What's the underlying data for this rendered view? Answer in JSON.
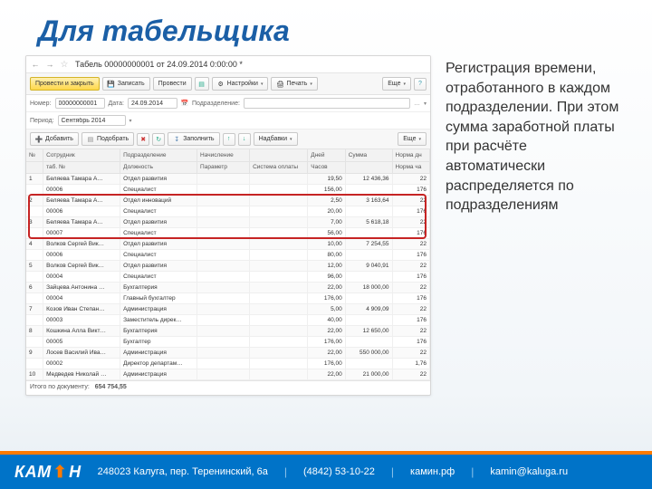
{
  "title": "Для табельщика",
  "side_text": "Регистрация времени, отработанного в каждом подразделении. При этом сумма заработной платы при расчёте автоматически распределяется по подразделениям",
  "app": {
    "doc_title": "Табель 00000000001 от 24.09.2014 0:00:00 *",
    "toolbar": {
      "post_close": "Провести и закрыть",
      "save": "Записать",
      "post": "Провести",
      "settings": "Настройки",
      "print": "Печать",
      "more": "Еще"
    },
    "form": {
      "number_lbl": "Номер:",
      "number": "00000000001",
      "date_lbl": "Дата:",
      "date": "24.09.2014",
      "sub_lbl": "Подразделение:",
      "sub": "",
      "period_lbl": "Период:",
      "period": "Сентябрь 2014"
    },
    "toolbar2": {
      "add": "Добавить",
      "pick": "Подобрать",
      "fill": "Заполнить",
      "bonus": "Надбавки",
      "more": "Еще"
    },
    "headers": {
      "r1": [
        "№",
        "Сотрудник",
        "Подразделение",
        "Начисление",
        "",
        "Дней",
        "Сумма",
        "Норма дн"
      ],
      "r2": [
        "",
        "таб. №",
        "Должность",
        "Параметр",
        "Система оплаты",
        "Часов",
        "",
        "Норма ча"
      ]
    },
    "rows": [
      {
        "n": "1",
        "emp": "Беляева Тамара А…",
        "dep": "Отдел развития",
        "calc": "",
        "sys": "",
        "days": "19,50",
        "sum": "12 436,36",
        "norm": "22"
      },
      {
        "n": "",
        "emp": "00006",
        "dep": "Специалист",
        "calc": "",
        "sys": "",
        "days": "156,00",
        "sum": "",
        "norm": "176"
      },
      {
        "n": "2",
        "emp": "Беляева Тамара А…",
        "dep": "Отдел инноваций",
        "calc": "",
        "sys": "",
        "days": "2,50",
        "sum": "3 163,64",
        "norm": "22"
      },
      {
        "n": "",
        "emp": "00006",
        "dep": "Специалист",
        "calc": "",
        "sys": "",
        "days": "20,00",
        "sum": "",
        "norm": "176"
      },
      {
        "n": "3",
        "emp": "Беляева Тамара А…",
        "dep": "Отдел развития",
        "calc": "",
        "sys": "",
        "days": "7,00",
        "sum": "5 618,18",
        "norm": "22"
      },
      {
        "n": "",
        "emp": "00007",
        "dep": "Специалист",
        "calc": "",
        "sys": "",
        "days": "56,00",
        "sum": "",
        "norm": "176"
      },
      {
        "n": "4",
        "emp": "Волков Сергей Вик…",
        "dep": "Отдел развития",
        "calc": "",
        "sys": "",
        "days": "10,00",
        "sum": "7 254,55",
        "norm": "22"
      },
      {
        "n": "",
        "emp": "00006",
        "dep": "Специалист",
        "calc": "",
        "sys": "",
        "days": "80,00",
        "sum": "",
        "norm": "176"
      },
      {
        "n": "5",
        "emp": "Волков Сергей Вик…",
        "dep": "Отдел развития",
        "calc": "",
        "sys": "",
        "days": "12,00",
        "sum": "9 040,91",
        "norm": "22"
      },
      {
        "n": "",
        "emp": "00004",
        "dep": "Специалист",
        "calc": "",
        "sys": "",
        "days": "96,00",
        "sum": "",
        "norm": "176"
      },
      {
        "n": "6",
        "emp": "Зайцева Антонина …",
        "dep": "Бухгалтерия",
        "calc": "",
        "sys": "",
        "days": "22,00",
        "sum": "18 000,00",
        "norm": "22"
      },
      {
        "n": "",
        "emp": "00004",
        "dep": "Главный бухгалтер",
        "calc": "",
        "sys": "",
        "days": "176,00",
        "sum": "",
        "norm": "176"
      },
      {
        "n": "7",
        "emp": "Козов Иван Степан…",
        "dep": "Администрация",
        "calc": "",
        "sys": "",
        "days": "5,00",
        "sum": "4 909,09",
        "norm": "22"
      },
      {
        "n": "",
        "emp": "00003",
        "dep": "Заместитель дирек…",
        "calc": "",
        "sys": "",
        "days": "40,00",
        "sum": "",
        "norm": "176"
      },
      {
        "n": "8",
        "emp": "Кошкина Алла Викт…",
        "dep": "Бухгалтерия",
        "calc": "",
        "sys": "",
        "days": "22,00",
        "sum": "12 650,00",
        "norm": "22"
      },
      {
        "n": "",
        "emp": "00005",
        "dep": "Бухгалтер",
        "calc": "",
        "sys": "",
        "days": "176,00",
        "sum": "",
        "norm": "176"
      },
      {
        "n": "9",
        "emp": "Лосев Василий Ива…",
        "dep": "Администрация",
        "calc": "",
        "sys": "",
        "days": "22,00",
        "sum": "550 000,00",
        "norm": "22"
      },
      {
        "n": "",
        "emp": "00002",
        "dep": "Директор департам…",
        "calc": "",
        "sys": "",
        "days": "176,00",
        "sum": "",
        "norm": "1,76"
      },
      {
        "n": "10",
        "emp": "Медведев Николай …",
        "dep": "Администрация",
        "calc": "",
        "sys": "",
        "days": "22,00",
        "sum": "21 000,00",
        "norm": "22"
      }
    ],
    "footer": {
      "label": "Итого по документу:",
      "total": "654 754,55"
    }
  },
  "bottom": {
    "logo": "КАМИН",
    "addr": "248023 Калуга, пер. Теренинский, 6а",
    "phone": "(4842) 53-10-22",
    "site": "камин.рф",
    "mail": "kamin@kaluga.ru"
  },
  "colors": {
    "accent": "#1b5fa6",
    "blue": "#0073c8",
    "orange": "#ff7a00",
    "highlight": "#c62424"
  }
}
